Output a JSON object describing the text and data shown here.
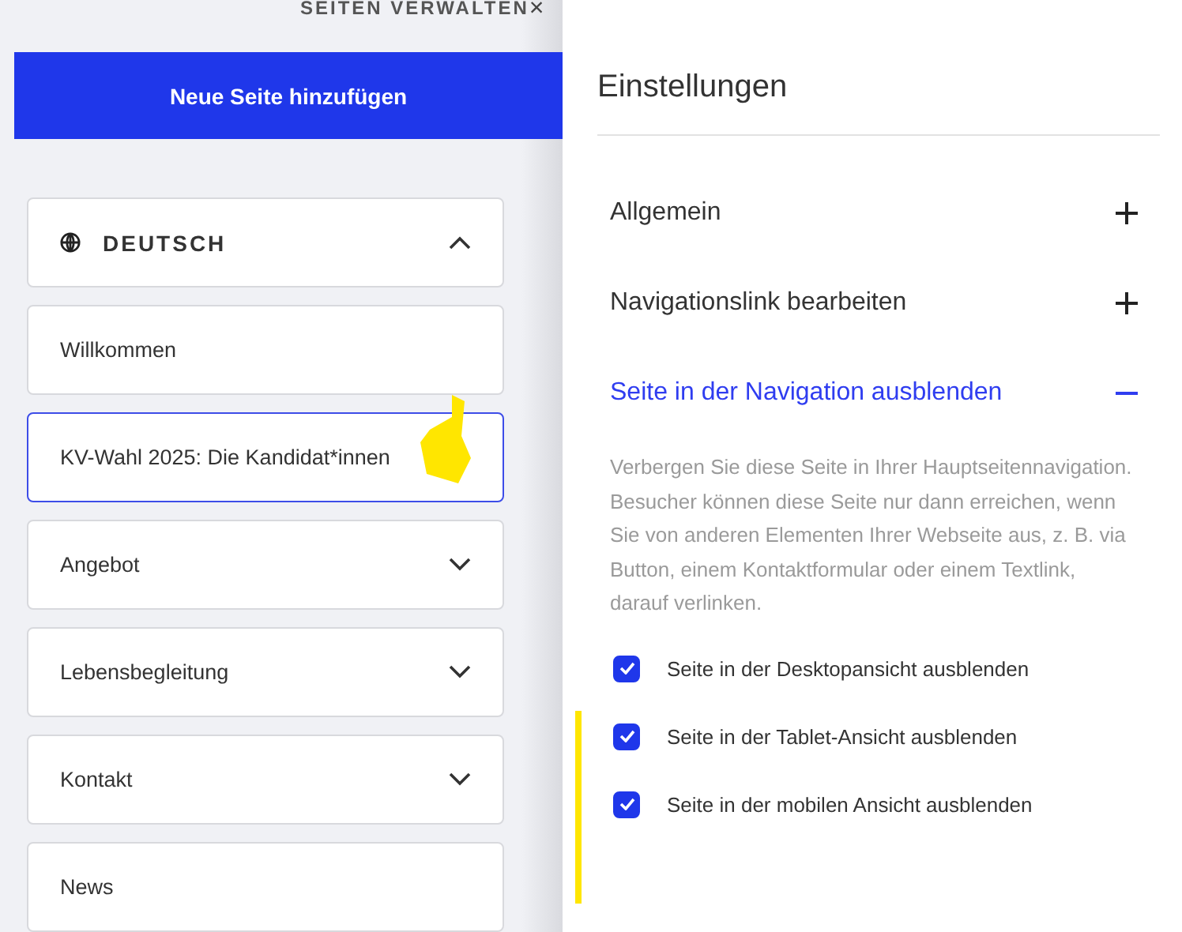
{
  "sidebar": {
    "title": "SEITEN VERWALTEN",
    "close": "×",
    "add_button": "Neue Seite hinzufügen",
    "language": {
      "label": "DEUTSCH",
      "expanded": true
    },
    "pages": [
      {
        "label": "Willkommen",
        "kind": "page",
        "selected": false
      },
      {
        "label": "KV-Wahl 2025: Die Kandidat*innen",
        "kind": "page",
        "selected": true
      },
      {
        "label": "Angebot",
        "kind": "folder",
        "selected": false,
        "expanded": false
      },
      {
        "label": "Lebensbegleitung",
        "kind": "folder",
        "selected": false,
        "expanded": false
      },
      {
        "label": "Kontakt",
        "kind": "folder",
        "selected": false,
        "expanded": false
      },
      {
        "label": "News",
        "kind": "page",
        "selected": false
      }
    ]
  },
  "settings": {
    "title": "Einstellungen",
    "sections": [
      {
        "label": "Allgemein",
        "expanded": false
      },
      {
        "label": "Navigationslink bearbeiten",
        "expanded": false
      },
      {
        "label": "Seite in der Navigation ausblenden",
        "expanded": true
      }
    ],
    "description": "Verbergen Sie diese Seite in Ihrer Hauptseitennavigation. Besucher können diese Seite nur dann erreichen, wenn Sie von anderen Elementen Ihrer Webseite aus, z. B. via Button, einem Kontaktformular oder einem Textlink, darauf verlinken.",
    "checkboxes": [
      {
        "label": "Seite in der Desktopansicht ausblenden",
        "checked": true
      },
      {
        "label": "Seite in der Tablet-Ansicht ausblenden",
        "checked": true
      },
      {
        "label": "Seite in der mobilen Ansicht ausblenden",
        "checked": true
      }
    ]
  }
}
